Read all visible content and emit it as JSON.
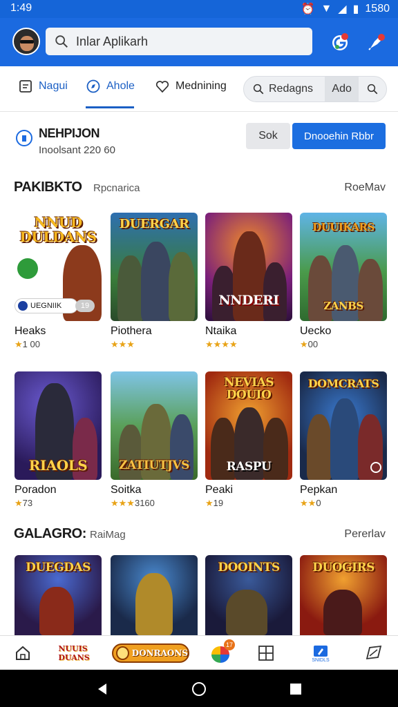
{
  "status": {
    "time": "1:49",
    "battery_text": "1580"
  },
  "header": {
    "search_text": "Inlar Aplikarh"
  },
  "tabs": [
    {
      "label": "Nagui",
      "icon": "document-icon",
      "active": false
    },
    {
      "label": "Ahole",
      "icon": "compass-icon",
      "active": true
    },
    {
      "label": "Mednining",
      "icon": "heart-icon",
      "active": false
    }
  ],
  "segment": {
    "search_label": "Redagns",
    "option_label": "Ado"
  },
  "info": {
    "title": "NEHPIJON",
    "subtitle": "Inoolsant 220 60",
    "button_secondary": "Sok",
    "button_primary": "Dnooehin Rbbr"
  },
  "sections": [
    {
      "title": "PAKIBKTO",
      "subtitle": "Rpcnarica",
      "more": "RoeMav",
      "items": [
        {
          "name": "Heaks",
          "rating": "1 00",
          "stars": "★",
          "logo": "NNUD DULDANS",
          "badge": "UEGNIIK",
          "badge2": "19"
        },
        {
          "name": "Piothera",
          "rating": "",
          "stars": "★★★",
          "logo": "DUERGAR"
        },
        {
          "name": "Ntaika",
          "rating": "",
          "stars": "★★★★",
          "logo": "NNDERI"
        },
        {
          "name": "Uecko",
          "rating": "00",
          "stars": "★",
          "logo": "ZANBS"
        },
        {
          "name": "Poradon",
          "rating": "73",
          "stars": "★",
          "logo": "RIAOLS"
        },
        {
          "name": "Soitka",
          "rating": "3160",
          "stars": "★★★",
          "logo": "ZATIUTJVS"
        },
        {
          "name": "Peaki",
          "rating": "19",
          "stars": "★",
          "logo": "RASPU"
        },
        {
          "name": "Pepkan",
          "rating": "0",
          "stars": "★★",
          "logo": "DOMCRATS"
        }
      ]
    },
    {
      "title": "GALAGRO:",
      "subtitle": "RaiMag",
      "more": "Pererlav",
      "items": [
        {
          "name": "",
          "logo": "DUEGDAS"
        },
        {
          "name": "",
          "logo": ""
        },
        {
          "name": "",
          "logo": "DOOINTS"
        },
        {
          "name": "",
          "logo": "DUOGIRS"
        }
      ]
    }
  ],
  "bottom_nav": {
    "home_icon": "home-icon",
    "logo2": "DONRAONS",
    "badge": "17",
    "active_label": "SNIDLS"
  },
  "colors": {
    "primary": "#1b6ae0",
    "accent": "#1c6ee0",
    "star": "#e8a317"
  }
}
